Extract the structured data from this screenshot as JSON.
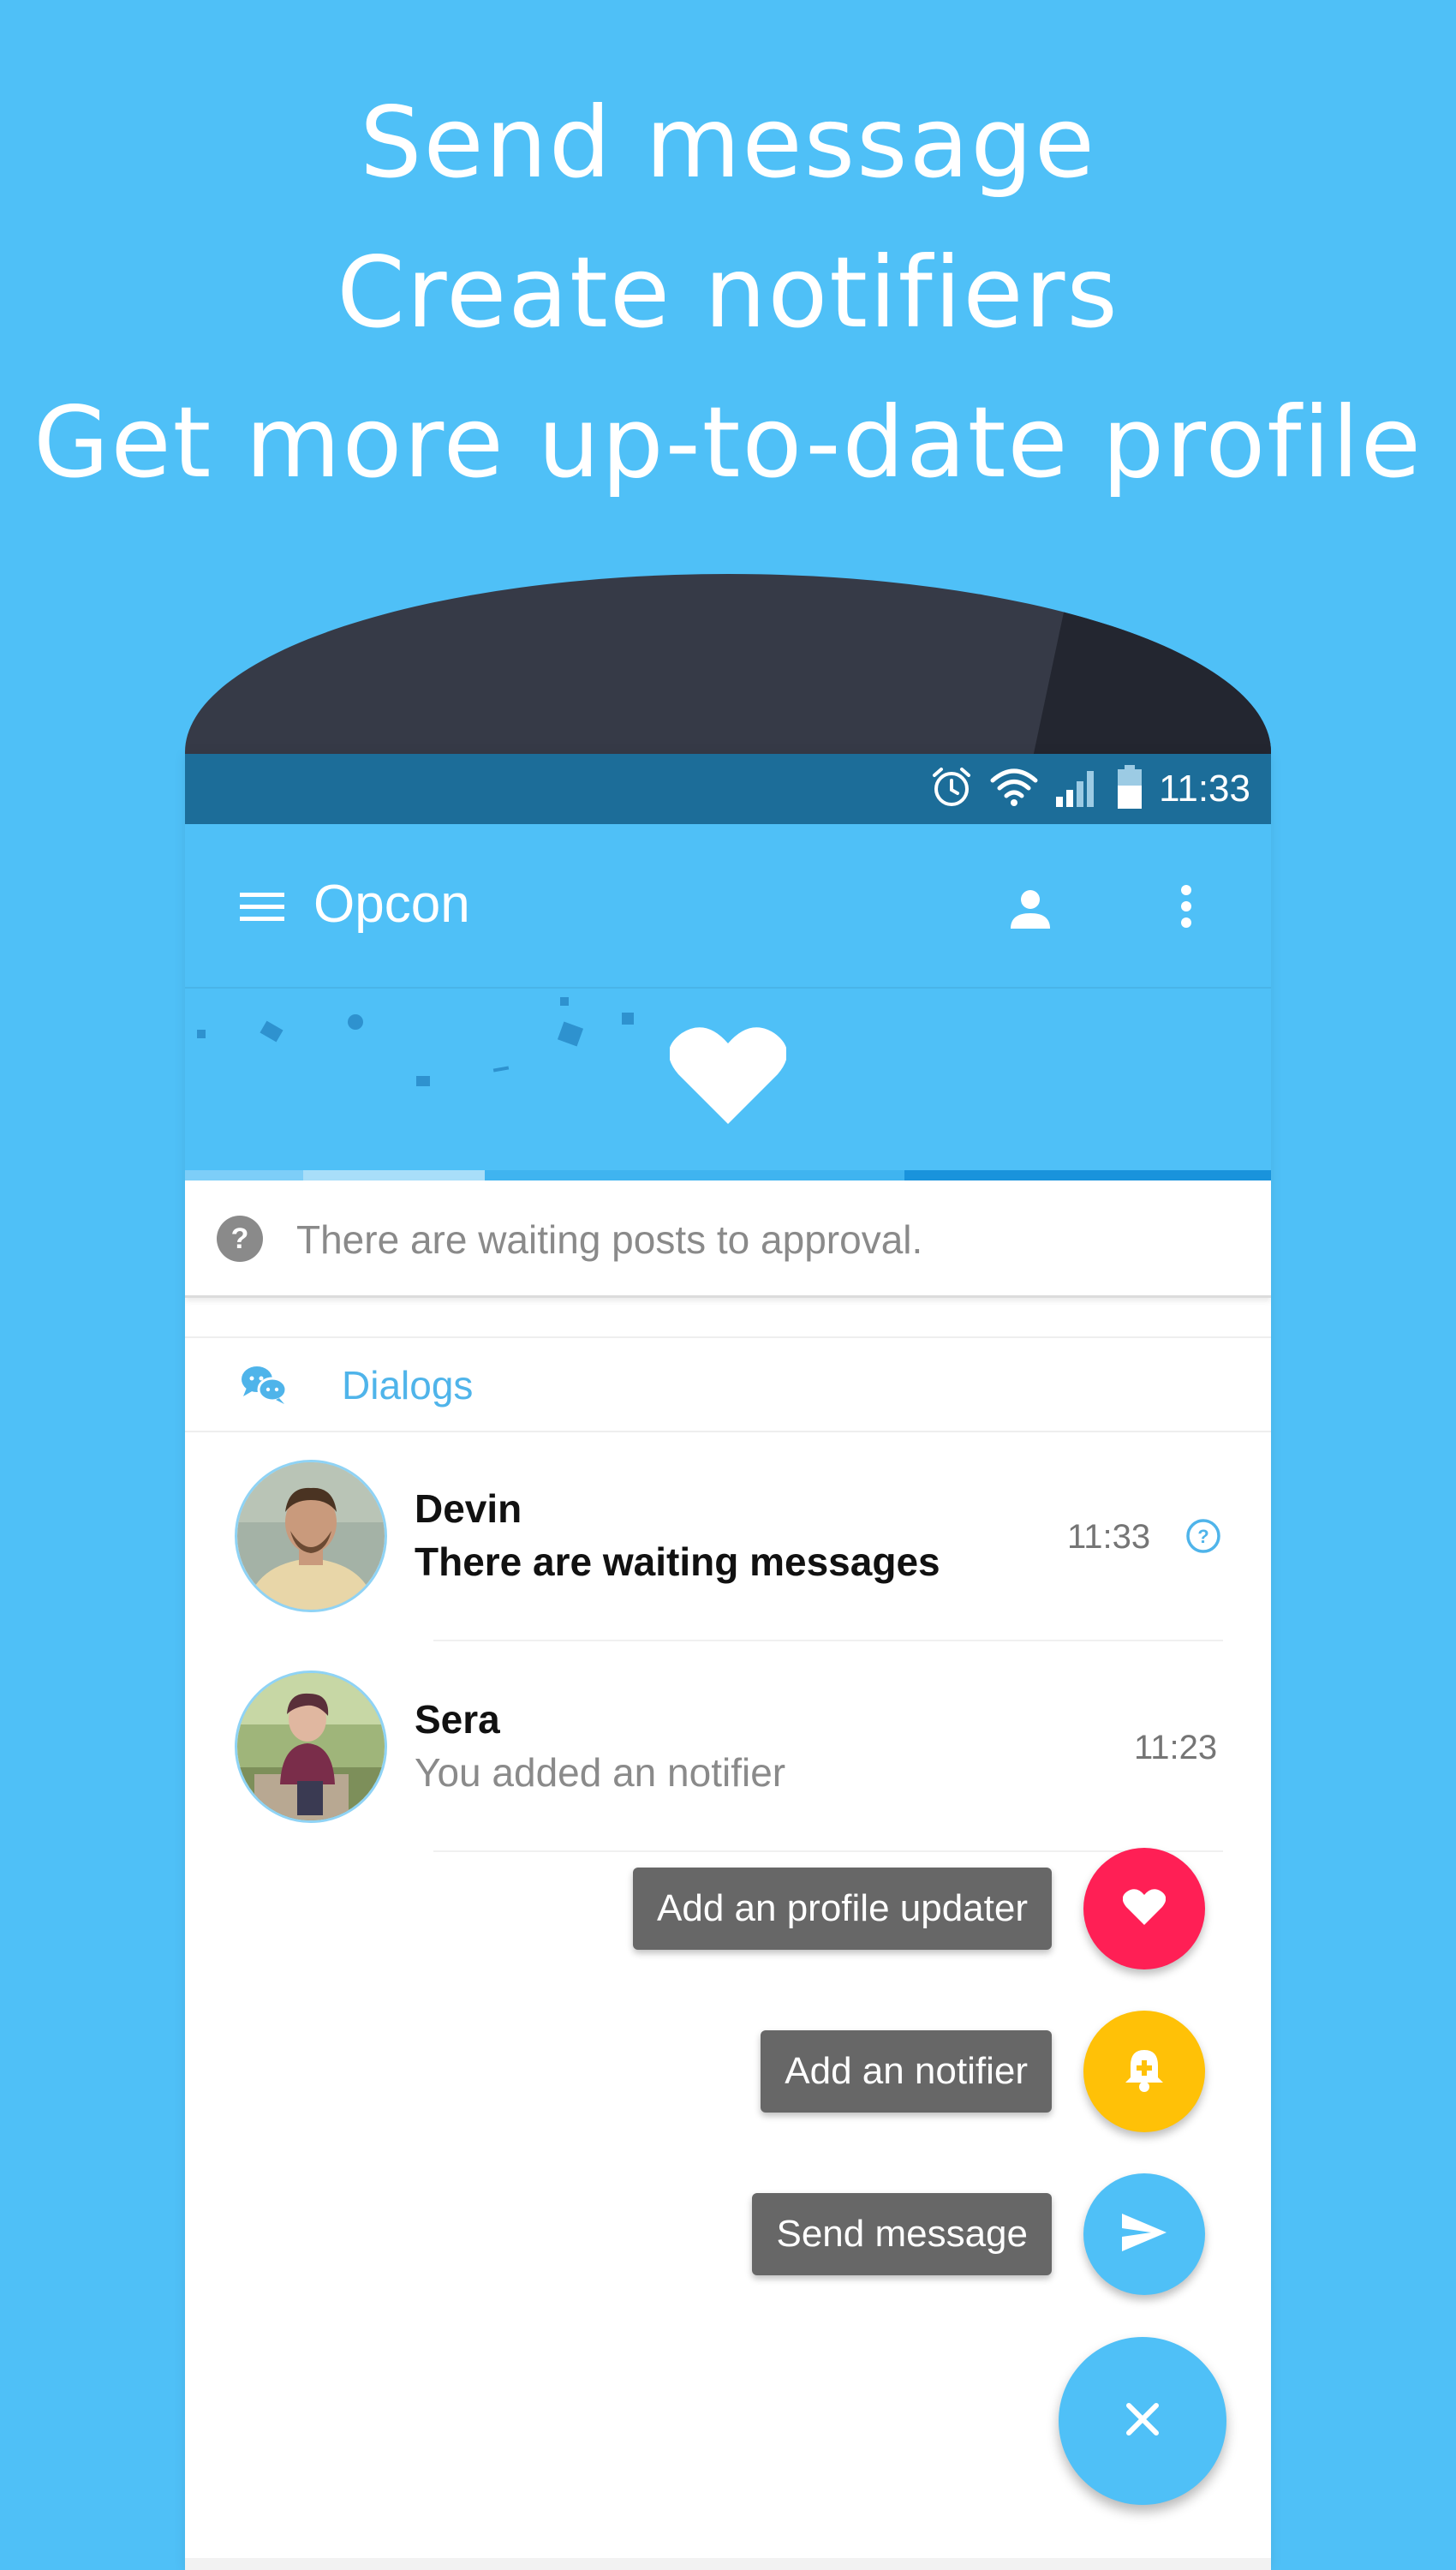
{
  "headlines": {
    "line1": "Send message",
    "line2": "Create notifiers",
    "line3": "Get more up-to-date profile"
  },
  "statusbar": {
    "time": "11:33",
    "icons": [
      "alarm-icon",
      "wifi-icon",
      "signal-icon",
      "battery-icon"
    ]
  },
  "appbar": {
    "title": "Opcon",
    "icons": [
      "menu-icon",
      "person-icon",
      "more-vert-icon"
    ]
  },
  "notice": {
    "text": "There are waiting posts to approval.",
    "icon": "help-icon"
  },
  "section": {
    "title": "Dialogs",
    "icon": "chat-icon"
  },
  "dialogs": [
    {
      "name": "Devin",
      "message": "There are waiting messages",
      "time": "11:33",
      "unread": true,
      "badge_icon": "question-badge-icon"
    },
    {
      "name": "Sera",
      "message": "You added an notifier",
      "time": "11:23",
      "unread": false
    }
  ],
  "fab_actions": [
    {
      "label": "Add an profile updater",
      "icon": "heart-icon",
      "color": "#ff1f55"
    },
    {
      "label": "Add an notifier",
      "icon": "bell-plus-icon",
      "color": "#ffc107"
    },
    {
      "label": "Send message",
      "icon": "send-icon",
      "color": "#4fc0f7"
    }
  ],
  "fab_main": {
    "icon": "close-icon",
    "color": "#4fc0f7"
  },
  "colors": {
    "background": "#4fc0f7",
    "statusbar": "#1c6d99",
    "accent": "#4fb4ea",
    "phone_body": "#363a47"
  }
}
